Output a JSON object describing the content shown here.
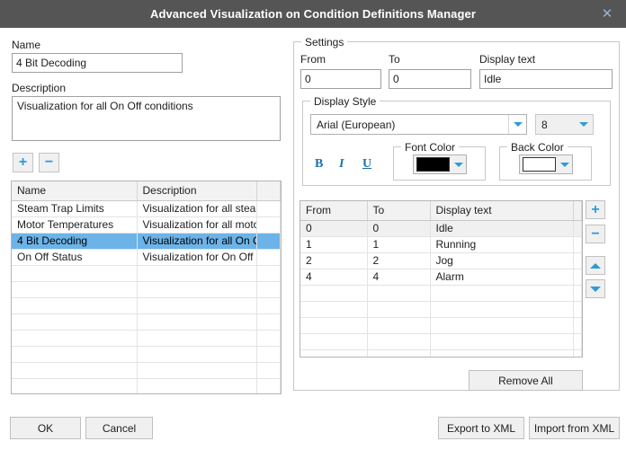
{
  "window": {
    "title": "Advanced Visualization on Condition Definitions Manager",
    "close_icon": "close-icon",
    "close_glyph": "✕",
    "titlebar_color": "#555555"
  },
  "left_panel": {
    "name_label": "Name",
    "name_value": "4 Bit Decoding",
    "description_label": "Description",
    "description_value": "Visualization for all On Off conditions",
    "add_button": "+",
    "remove_button": "−",
    "table": {
      "columns": [
        "Name",
        "Description",
        ""
      ],
      "rows": [
        {
          "name": "Steam Trap Limits",
          "description": "Visualization for all steam tra",
          "selected": false
        },
        {
          "name": "Motor Temperatures",
          "description": "Visualization for all motor mo",
          "selected": false
        },
        {
          "name": "4 Bit Decoding",
          "description": "Visualization for all On Off c",
          "selected": true
        },
        {
          "name": "On Off Status",
          "description": "Visualization for On Off Stat",
          "selected": false
        }
      ],
      "empty_row_count": 9,
      "selection_color": "#6cb3e8"
    }
  },
  "settings": {
    "caption": "Settings",
    "from_label": "From",
    "from_value": "0",
    "to_label": "To",
    "to_value": "0",
    "display_text_label": "Display text",
    "display_text_value": "Idle",
    "display_style": {
      "caption": "Display Style",
      "font_family_value": "Arial (European)",
      "font_size_value": "8",
      "bold_label": "B",
      "italic_label": "I",
      "underline_label": "U",
      "font_color": {
        "caption": "Font Color",
        "value": "#000000"
      },
      "back_color": {
        "caption": "Back Color",
        "value": "#ffffff"
      },
      "accent_color": "#2e9bd6"
    },
    "table": {
      "columns": [
        "From",
        "To",
        "Display text",
        ""
      ],
      "rows": [
        {
          "from": "0",
          "to": "0",
          "display_text": "Idle",
          "highlighted": true
        },
        {
          "from": "1",
          "to": "1",
          "display_text": "Running",
          "highlighted": false
        },
        {
          "from": "2",
          "to": "2",
          "display_text": "Jog",
          "highlighted": false
        },
        {
          "from": "4",
          "to": "4",
          "display_text": "Alarm",
          "highlighted": false
        }
      ],
      "empty_row_count": 7
    },
    "side_buttons": {
      "add": "+",
      "remove": "−",
      "move_up": "move-up-arrow",
      "move_down": "move-down-arrow"
    },
    "remove_all_label": "Remove All"
  },
  "footer": {
    "ok_label": "OK",
    "cancel_label": "Cancel",
    "export_label": "Export to XML",
    "import_label": "Import from XML"
  }
}
